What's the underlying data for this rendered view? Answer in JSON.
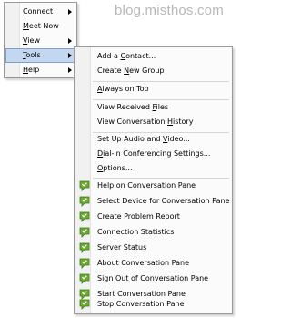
{
  "watermark": "blog.misthos.com",
  "main_menu": {
    "items": [
      {
        "label_before": "",
        "accel": "C",
        "label_after": "onnect",
        "has_submenu": true
      },
      {
        "label_before": "",
        "accel": "M",
        "label_after": "eet Now",
        "has_submenu": false
      },
      {
        "label_before": "",
        "accel": "V",
        "label_after": "iew",
        "has_submenu": true
      },
      {
        "label_before": "",
        "accel": "T",
        "label_after": "ools",
        "has_submenu": true,
        "highlighted": true
      },
      {
        "label_before": "",
        "accel": "H",
        "label_after": "elp",
        "has_submenu": true
      }
    ]
  },
  "tools_menu": {
    "items": [
      {
        "label_before": "Add a ",
        "accel": "C",
        "label_after": "ontact..."
      },
      {
        "label_before": "Create ",
        "accel": "N",
        "label_after": "ew Group"
      },
      {
        "label_before": "",
        "accel": "A",
        "label_after": "lways on Top"
      },
      {
        "label_before": "View Received ",
        "accel": "F",
        "label_after": "iles"
      },
      {
        "label_before": "View Conversation ",
        "accel": "H",
        "label_after": "istory"
      },
      {
        "label_before": "Set Up Audio and ",
        "accel": "V",
        "label_after": "ideo..."
      },
      {
        "label_before": "",
        "accel": "D",
        "label_after": "ial-in Conferencing Settings..."
      },
      {
        "label_before": "",
        "accel": "O",
        "label_after": "ptions..."
      },
      {
        "label_before": "",
        "accel": "",
        "label_after": "Help on Conversation Pane",
        "icon": "conversation-pane-icon"
      },
      {
        "label_before": "",
        "accel": "",
        "label_after": "Select Device for Conversation Pane",
        "icon": "conversation-pane-icon"
      },
      {
        "label_before": "",
        "accel": "",
        "label_after": "Create Problem Report",
        "icon": "conversation-pane-icon"
      },
      {
        "label_before": "",
        "accel": "",
        "label_after": "Connection Statistics",
        "icon": "conversation-pane-icon"
      },
      {
        "label_before": "",
        "accel": "",
        "label_after": "Server Status",
        "icon": "conversation-pane-icon"
      },
      {
        "label_before": "",
        "accel": "",
        "label_after": "About Conversation Pane",
        "icon": "conversation-pane-icon"
      },
      {
        "label_before": "",
        "accel": "",
        "label_after": "Sign Out of Conversation Pane",
        "icon": "conversation-pane-icon"
      },
      {
        "label_before": "",
        "accel": "",
        "label_after": "Start Conversation Pane",
        "icon": "conversation-pane-icon"
      },
      {
        "label_before": "",
        "accel": "",
        "label_after": "Stop Conversation Pane",
        "icon": "conversation-pane-icon"
      }
    ]
  },
  "colors": {
    "highlight": "#c3d7f1",
    "highlight_border": "#7f9fd1",
    "icon_green": "#6aab2e"
  }
}
